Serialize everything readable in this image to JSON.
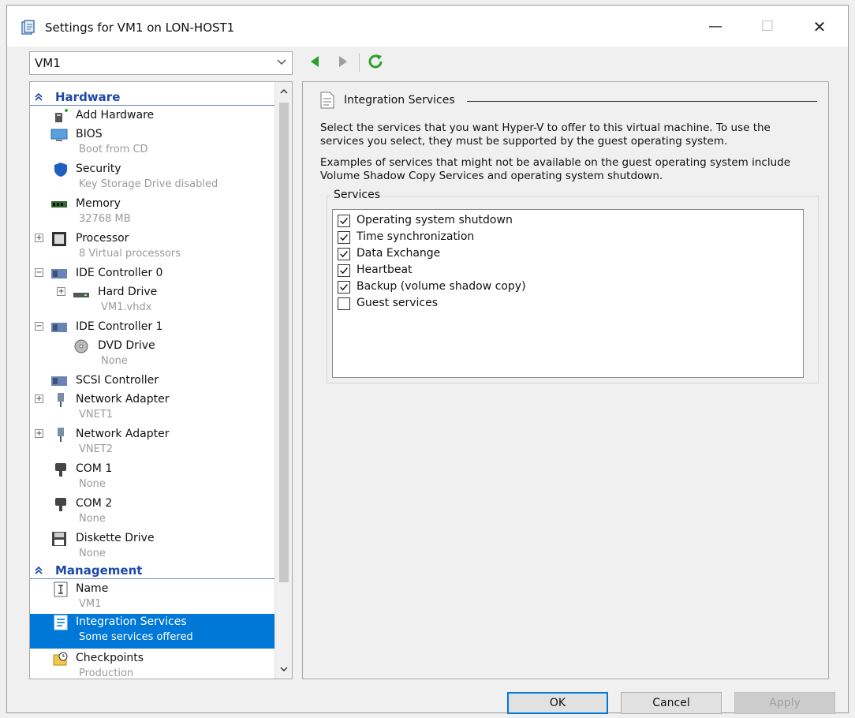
{
  "window": {
    "title": "Settings for VM1 on LON-HOST1",
    "minimize": "—",
    "maximize": "☐",
    "close": "✕"
  },
  "vm_selector": {
    "value": "VM1"
  },
  "sections": {
    "hardware": "Hardware",
    "management": "Management"
  },
  "tree_items": [
    {
      "name": "Add Hardware",
      "sub": ""
    },
    {
      "name": "BIOS",
      "sub": "Boot from CD"
    },
    {
      "name": "Security",
      "sub": "Key Storage Drive disabled"
    },
    {
      "name": "Memory",
      "sub": "32768 MB"
    },
    {
      "name": "Processor",
      "sub": "8 Virtual processors"
    },
    {
      "name": "IDE Controller 0",
      "sub": ""
    },
    {
      "name": "Hard Drive",
      "sub": "VM1.vhdx"
    },
    {
      "name": "IDE Controller 1",
      "sub": ""
    },
    {
      "name": "DVD Drive",
      "sub": "None"
    },
    {
      "name": "SCSI Controller",
      "sub": ""
    },
    {
      "name": "Network Adapter",
      "sub": "VNET1"
    },
    {
      "name": "Network Adapter",
      "sub": "VNET2"
    },
    {
      "name": "COM 1",
      "sub": "None"
    },
    {
      "name": "COM 2",
      "sub": "None"
    },
    {
      "name": "Diskette Drive",
      "sub": "None"
    },
    {
      "name": "Name",
      "sub": "VM1"
    },
    {
      "name": "Integration Services",
      "sub": "Some services offered"
    },
    {
      "name": "Checkpoints",
      "sub": "Production"
    }
  ],
  "panel": {
    "title": "Integration Services",
    "desc1": "Select the services that you want Hyper-V to offer to this virtual machine. To use the services you select, they must be supported by the guest operating system.",
    "desc2": "Examples of services that might not be available on the guest operating system include Volume Shadow Copy Services and operating system shutdown.",
    "group_label": "Services",
    "services": [
      {
        "label": "Operating system shutdown",
        "checked": true
      },
      {
        "label": "Time synchronization",
        "checked": true
      },
      {
        "label": "Data Exchange",
        "checked": true
      },
      {
        "label": "Heartbeat",
        "checked": true
      },
      {
        "label": "Backup (volume shadow copy)",
        "checked": true
      },
      {
        "label": "Guest services",
        "checked": false
      }
    ]
  },
  "buttons": {
    "ok": "OK",
    "cancel": "Cancel",
    "apply": "Apply"
  },
  "colors": {
    "selection": "#0078d7",
    "section_text": "#1c4aa6",
    "nav_green": "#2aa02a"
  }
}
